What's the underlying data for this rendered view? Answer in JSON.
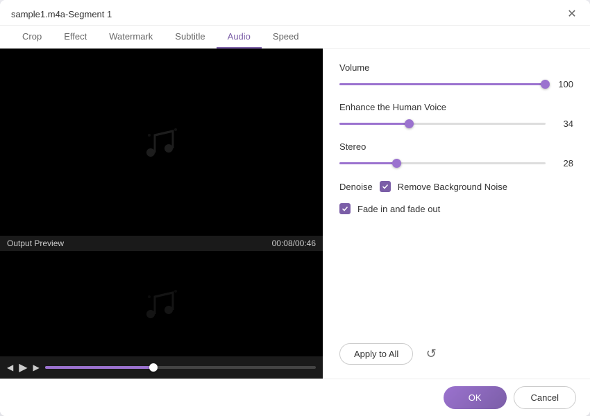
{
  "title": "sample1.m4a-Segment 1",
  "tabs": [
    {
      "label": "Crop",
      "active": false
    },
    {
      "label": "Effect",
      "active": false
    },
    {
      "label": "Watermark",
      "active": false
    },
    {
      "label": "Subtitle",
      "active": false
    },
    {
      "label": "Audio",
      "active": true
    },
    {
      "label": "Speed",
      "active": false
    }
  ],
  "output_label": "Output Preview",
  "output_time": "00:08/00:46",
  "controls": {
    "volume": {
      "label": "Volume",
      "value": 100,
      "fill_pct": 100
    },
    "enhance": {
      "label": "Enhance the Human Voice",
      "value": 34,
      "fill_pct": 34
    },
    "stereo": {
      "label": "Stereo",
      "value": 28,
      "fill_pct": 28
    }
  },
  "denoise": {
    "label": "Denoise",
    "checkbox_checked": true,
    "checkbox_label": "Remove Background Noise"
  },
  "fade": {
    "checkbox_checked": true,
    "label": "Fade in and fade out"
  },
  "buttons": {
    "apply_all": "Apply to All",
    "ok": "OK",
    "cancel": "Cancel"
  },
  "icons": {
    "close": "✕",
    "play": "▶",
    "prev": "◀",
    "next": "▶",
    "reset": "↺",
    "check": "✓"
  }
}
